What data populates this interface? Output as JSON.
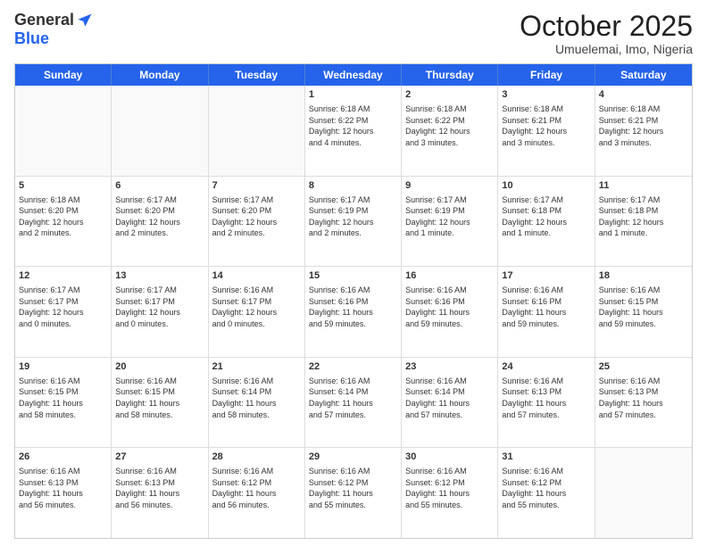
{
  "header": {
    "logo_general": "General",
    "logo_blue": "Blue",
    "month_title": "October 2025",
    "location": "Umuelemai, Imo, Nigeria"
  },
  "weekdays": [
    "Sunday",
    "Monday",
    "Tuesday",
    "Wednesday",
    "Thursday",
    "Friday",
    "Saturday"
  ],
  "rows": [
    [
      {
        "day": "",
        "info": "",
        "empty": true
      },
      {
        "day": "",
        "info": "",
        "empty": true
      },
      {
        "day": "",
        "info": "",
        "empty": true
      },
      {
        "day": "1",
        "info": "Sunrise: 6:18 AM\nSunset: 6:22 PM\nDaylight: 12 hours\nand 4 minutes.",
        "empty": false
      },
      {
        "day": "2",
        "info": "Sunrise: 6:18 AM\nSunset: 6:22 PM\nDaylight: 12 hours\nand 3 minutes.",
        "empty": false
      },
      {
        "day": "3",
        "info": "Sunrise: 6:18 AM\nSunset: 6:21 PM\nDaylight: 12 hours\nand 3 minutes.",
        "empty": false
      },
      {
        "day": "4",
        "info": "Sunrise: 6:18 AM\nSunset: 6:21 PM\nDaylight: 12 hours\nand 3 minutes.",
        "empty": false
      }
    ],
    [
      {
        "day": "5",
        "info": "Sunrise: 6:18 AM\nSunset: 6:20 PM\nDaylight: 12 hours\nand 2 minutes.",
        "empty": false
      },
      {
        "day": "6",
        "info": "Sunrise: 6:17 AM\nSunset: 6:20 PM\nDaylight: 12 hours\nand 2 minutes.",
        "empty": false
      },
      {
        "day": "7",
        "info": "Sunrise: 6:17 AM\nSunset: 6:20 PM\nDaylight: 12 hours\nand 2 minutes.",
        "empty": false
      },
      {
        "day": "8",
        "info": "Sunrise: 6:17 AM\nSunset: 6:19 PM\nDaylight: 12 hours\nand 2 minutes.",
        "empty": false
      },
      {
        "day": "9",
        "info": "Sunrise: 6:17 AM\nSunset: 6:19 PM\nDaylight: 12 hours\nand 1 minute.",
        "empty": false
      },
      {
        "day": "10",
        "info": "Sunrise: 6:17 AM\nSunset: 6:18 PM\nDaylight: 12 hours\nand 1 minute.",
        "empty": false
      },
      {
        "day": "11",
        "info": "Sunrise: 6:17 AM\nSunset: 6:18 PM\nDaylight: 12 hours\nand 1 minute.",
        "empty": false
      }
    ],
    [
      {
        "day": "12",
        "info": "Sunrise: 6:17 AM\nSunset: 6:17 PM\nDaylight: 12 hours\nand 0 minutes.",
        "empty": false
      },
      {
        "day": "13",
        "info": "Sunrise: 6:17 AM\nSunset: 6:17 PM\nDaylight: 12 hours\nand 0 minutes.",
        "empty": false
      },
      {
        "day": "14",
        "info": "Sunrise: 6:16 AM\nSunset: 6:17 PM\nDaylight: 12 hours\nand 0 minutes.",
        "empty": false
      },
      {
        "day": "15",
        "info": "Sunrise: 6:16 AM\nSunset: 6:16 PM\nDaylight: 11 hours\nand 59 minutes.",
        "empty": false
      },
      {
        "day": "16",
        "info": "Sunrise: 6:16 AM\nSunset: 6:16 PM\nDaylight: 11 hours\nand 59 minutes.",
        "empty": false
      },
      {
        "day": "17",
        "info": "Sunrise: 6:16 AM\nSunset: 6:16 PM\nDaylight: 11 hours\nand 59 minutes.",
        "empty": false
      },
      {
        "day": "18",
        "info": "Sunrise: 6:16 AM\nSunset: 6:15 PM\nDaylight: 11 hours\nand 59 minutes.",
        "empty": false
      }
    ],
    [
      {
        "day": "19",
        "info": "Sunrise: 6:16 AM\nSunset: 6:15 PM\nDaylight: 11 hours\nand 58 minutes.",
        "empty": false
      },
      {
        "day": "20",
        "info": "Sunrise: 6:16 AM\nSunset: 6:15 PM\nDaylight: 11 hours\nand 58 minutes.",
        "empty": false
      },
      {
        "day": "21",
        "info": "Sunrise: 6:16 AM\nSunset: 6:14 PM\nDaylight: 11 hours\nand 58 minutes.",
        "empty": false
      },
      {
        "day": "22",
        "info": "Sunrise: 6:16 AM\nSunset: 6:14 PM\nDaylight: 11 hours\nand 57 minutes.",
        "empty": false
      },
      {
        "day": "23",
        "info": "Sunrise: 6:16 AM\nSunset: 6:14 PM\nDaylight: 11 hours\nand 57 minutes.",
        "empty": false
      },
      {
        "day": "24",
        "info": "Sunrise: 6:16 AM\nSunset: 6:13 PM\nDaylight: 11 hours\nand 57 minutes.",
        "empty": false
      },
      {
        "day": "25",
        "info": "Sunrise: 6:16 AM\nSunset: 6:13 PM\nDaylight: 11 hours\nand 57 minutes.",
        "empty": false
      }
    ],
    [
      {
        "day": "26",
        "info": "Sunrise: 6:16 AM\nSunset: 6:13 PM\nDaylight: 11 hours\nand 56 minutes.",
        "empty": false
      },
      {
        "day": "27",
        "info": "Sunrise: 6:16 AM\nSunset: 6:13 PM\nDaylight: 11 hours\nand 56 minutes.",
        "empty": false
      },
      {
        "day": "28",
        "info": "Sunrise: 6:16 AM\nSunset: 6:12 PM\nDaylight: 11 hours\nand 56 minutes.",
        "empty": false
      },
      {
        "day": "29",
        "info": "Sunrise: 6:16 AM\nSunset: 6:12 PM\nDaylight: 11 hours\nand 55 minutes.",
        "empty": false
      },
      {
        "day": "30",
        "info": "Sunrise: 6:16 AM\nSunset: 6:12 PM\nDaylight: 11 hours\nand 55 minutes.",
        "empty": false
      },
      {
        "day": "31",
        "info": "Sunrise: 6:16 AM\nSunset: 6:12 PM\nDaylight: 11 hours\nand 55 minutes.",
        "empty": false
      },
      {
        "day": "",
        "info": "",
        "empty": true
      }
    ]
  ]
}
